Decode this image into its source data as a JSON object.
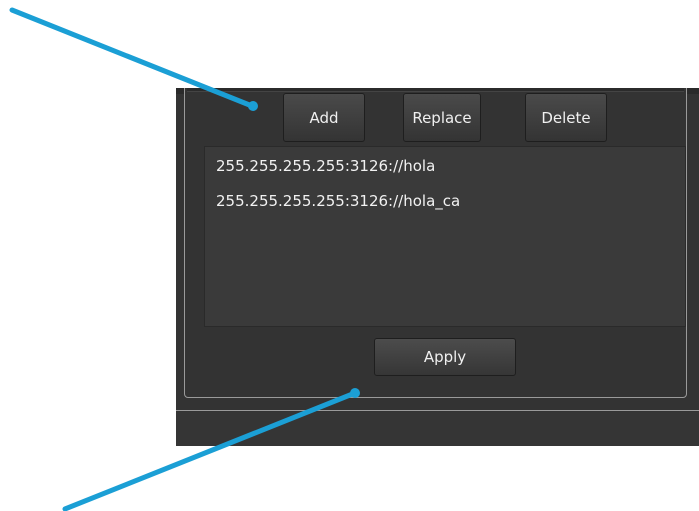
{
  "buttons": {
    "add": "Add",
    "replace": "Replace",
    "delete": "Delete",
    "apply": "Apply"
  },
  "proxy_list": {
    "items": [
      "255.255.255.255:3126://hola",
      "255.255.255.255:3126://hola_ca"
    ]
  },
  "colors": {
    "panel_bg": "#333333",
    "annotation_arrow": "#1b9fd5"
  }
}
